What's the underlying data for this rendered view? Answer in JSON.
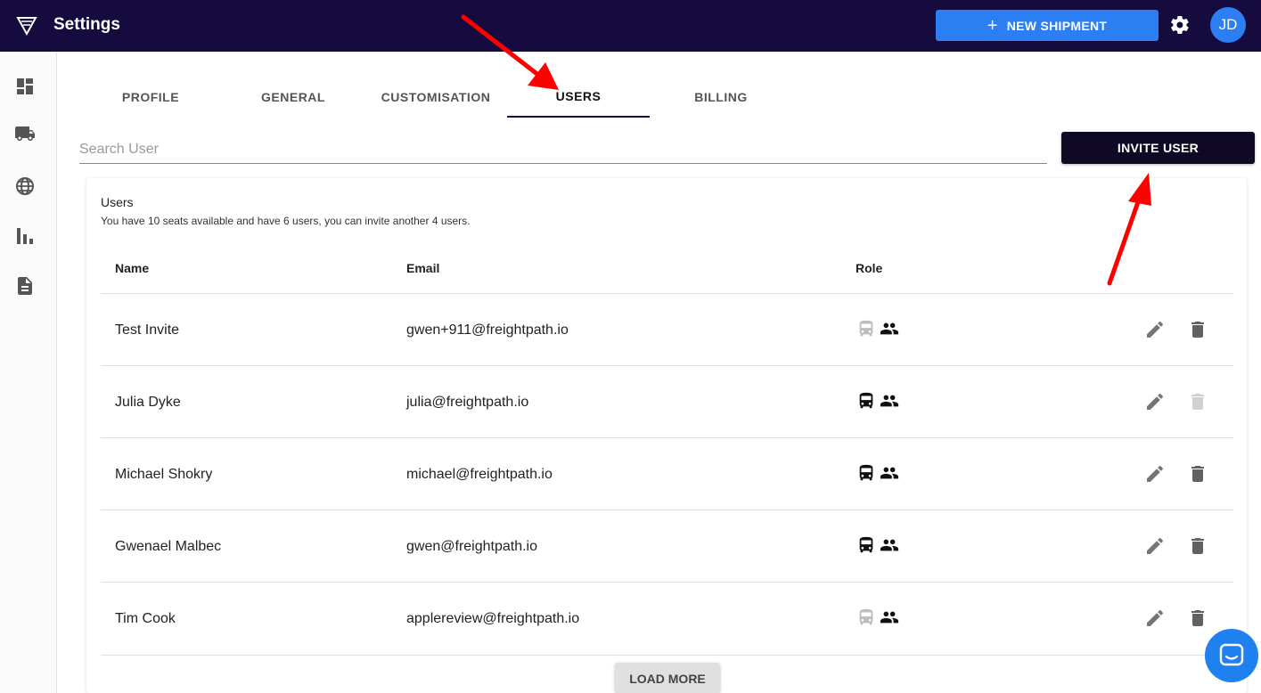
{
  "header": {
    "title": "Settings",
    "new_shipment_label": "NEW SHIPMENT",
    "avatar_initials": "JD"
  },
  "tabs": [
    {
      "label": "PROFILE"
    },
    {
      "label": "GENERAL"
    },
    {
      "label": "CUSTOMISATION"
    },
    {
      "label": "USERS",
      "active": true
    },
    {
      "label": "BILLING"
    }
  ],
  "search": {
    "placeholder": "Search User",
    "value": ""
  },
  "invite_label": "INVITE USER",
  "users_card": {
    "title": "Users",
    "subtitle": "You have 10 seats available and have 6 users, you can invite another 4 users.",
    "columns": {
      "name": "Name",
      "email": "Email",
      "role": "Role"
    },
    "rows": [
      {
        "name": "Test Invite",
        "email": "gwen+911@freightpath.io"
      },
      {
        "name": "Julia Dyke",
        "email": "julia@freightpath.io"
      },
      {
        "name": "Michael Shokry",
        "email": "michael@freightpath.io"
      },
      {
        "name": "Gwenael Malbec",
        "email": "gwen@freightpath.io"
      },
      {
        "name": "Tim Cook",
        "email": "applereview@freightpath.io"
      }
    ],
    "load_more_label": "LOAD MORE"
  },
  "colors": {
    "topbar": "#150b3e",
    "accent": "#2b7ff3",
    "invite_button": "#0f0926",
    "annotation_arrow": "#ff0000"
  },
  "icons": {
    "logo": "logo-icon",
    "settings": "gear-icon",
    "sidebar": [
      "dashboard-icon",
      "truck-icon",
      "globe-icon",
      "bar-chart-icon",
      "document-icon"
    ],
    "role": [
      "bus-icon",
      "people-icon"
    ],
    "actions": [
      "edit-icon",
      "delete-icon"
    ],
    "chat": "chat-icon"
  }
}
